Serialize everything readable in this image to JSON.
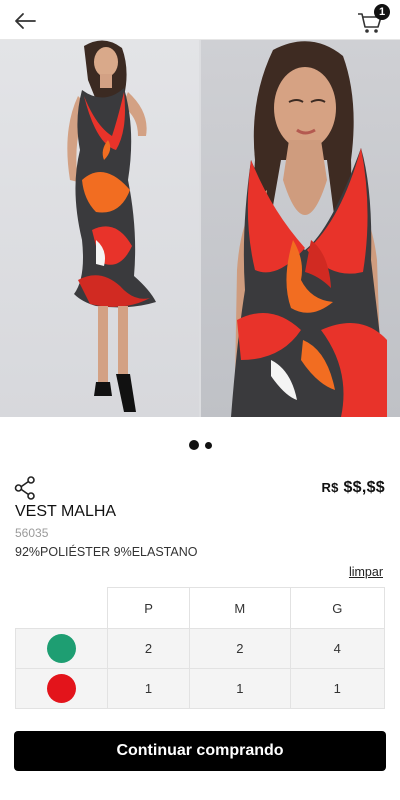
{
  "header": {
    "back_icon": "arrow-left-icon",
    "cart_icon": "shopping-cart-icon",
    "cart_count": "1"
  },
  "gallery": {
    "total_images": 2,
    "active_index": 0
  },
  "product": {
    "share_icon": "share-icon",
    "price_currency": "R$",
    "price_value": "$$,$$",
    "name": "VEST MALHA",
    "sku": "56035",
    "composition": "92%POLIÉSTER 9%ELASTANO"
  },
  "selection": {
    "clear_label": "limpar",
    "sizes": [
      "P",
      "M",
      "G"
    ],
    "colors": [
      {
        "swatch": "#1e9e72",
        "quantities": [
          "2",
          "2",
          "4"
        ]
      },
      {
        "swatch": "#e3141b",
        "quantities": [
          "1",
          "1",
          "1"
        ]
      }
    ]
  },
  "footer": {
    "button_label": "Continuar comprando"
  },
  "colors": {
    "primary_button": "#000000",
    "badge": "#111111",
    "dress_red": "#e8332a",
    "dress_orange": "#f26d21",
    "dress_dark": "#3a3a3d"
  }
}
